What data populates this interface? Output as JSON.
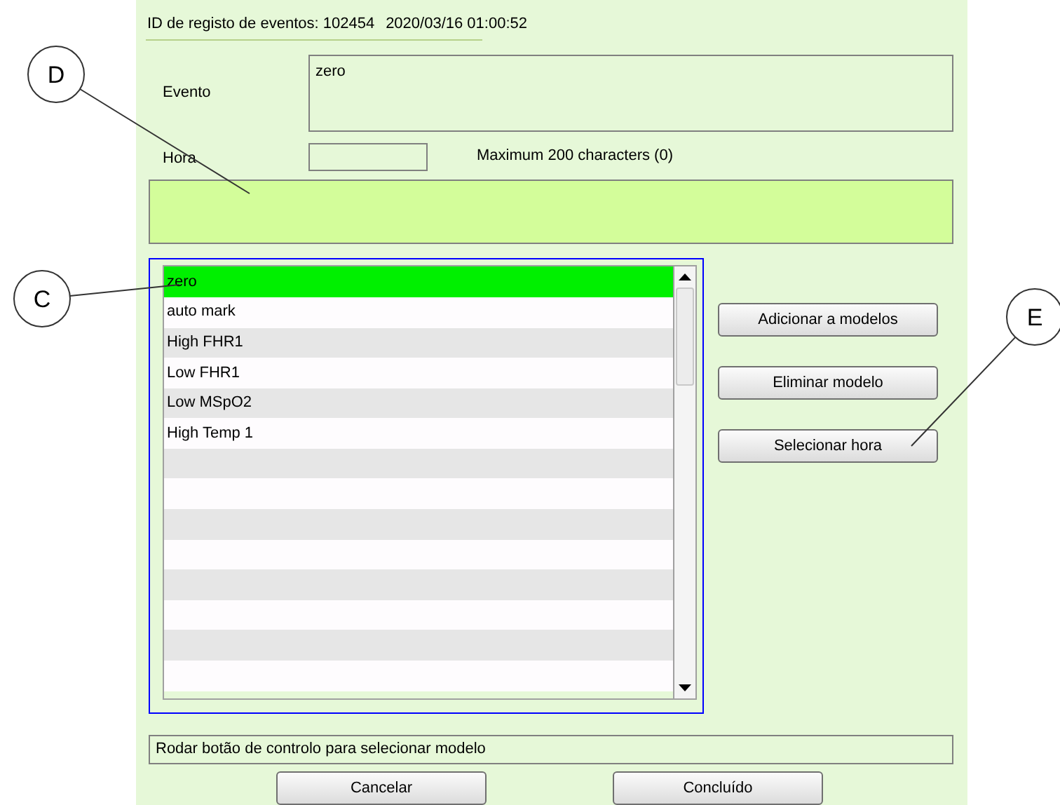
{
  "header": {
    "record_id": "ID de registo de eventos: 102454",
    "timestamp": "2020/03/16 01:00:52"
  },
  "event": {
    "label": "Evento",
    "value": "zero"
  },
  "time": {
    "label": "Hora"
  },
  "char_count": "Maximum 200 characters (0)",
  "templates": [
    {
      "name": "zero",
      "selected": true
    },
    {
      "name": "auto mark",
      "selected": false
    },
    {
      "name": "High FHR1",
      "selected": false
    },
    {
      "name": "Low FHR1",
      "selected": false
    },
    {
      "name": "Low MSpO2",
      "selected": false
    },
    {
      "name": "High Temp 1",
      "selected": false
    }
  ],
  "side_buttons": [
    "Adicionar a modelos",
    "Eliminar modelo",
    "Selecionar hora"
  ],
  "status": "Rodar botão de controlo para selecionar modelo",
  "footer_buttons": [
    "Cancelar",
    "Concluído"
  ],
  "callouts": [
    {
      "label": "D"
    },
    {
      "label": "C"
    },
    {
      "label": "E"
    }
  ]
}
